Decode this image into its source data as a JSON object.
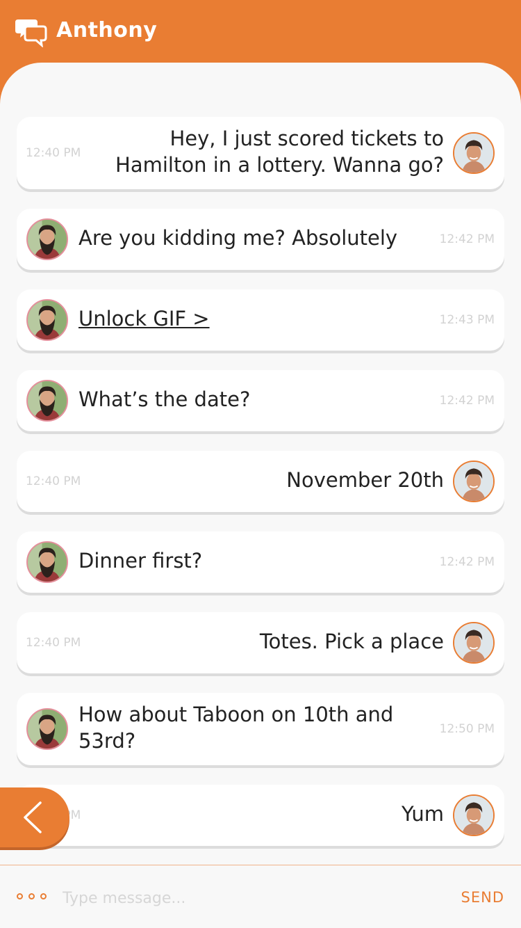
{
  "header": {
    "title": "Anthony",
    "icon": "chat-bubbles-icon"
  },
  "colors": {
    "accent": "#e97d33",
    "timestamp": "#d2d2d2",
    "bubble": "#ffffff",
    "background": "#f8f8f8"
  },
  "messages": [
    {
      "direction": "out",
      "text": "Hey, I just scored tickets to\nHamilton in a lottery. Wanna go?",
      "time": "12:40 PM"
    },
    {
      "direction": "in",
      "text": "Are you kidding me? Absolutely",
      "time": "12:42 PM"
    },
    {
      "direction": "in",
      "text": "Unlock GIF >",
      "time": "12:43 PM",
      "link": true
    },
    {
      "direction": "in",
      "text": "What’s the date?",
      "time": "12:42 PM"
    },
    {
      "direction": "out",
      "text": "November 20th",
      "time": "12:40 PM"
    },
    {
      "direction": "in",
      "text": "Dinner first?",
      "time": "12:42 PM"
    },
    {
      "direction": "out",
      "text": "Totes. Pick a place",
      "time": "12:40 PM"
    },
    {
      "direction": "in",
      "text": "How about Taboon on 10th and\n53rd?",
      "time": "12:50 PM"
    },
    {
      "direction": "out",
      "text": "Yum",
      "time": "12:40 PM"
    }
  ],
  "composer": {
    "placeholder": "Type message...",
    "send_label": "SEND",
    "more_icon": "more-dots-icon"
  },
  "back_button": {
    "icon": "chevron-left-icon"
  }
}
